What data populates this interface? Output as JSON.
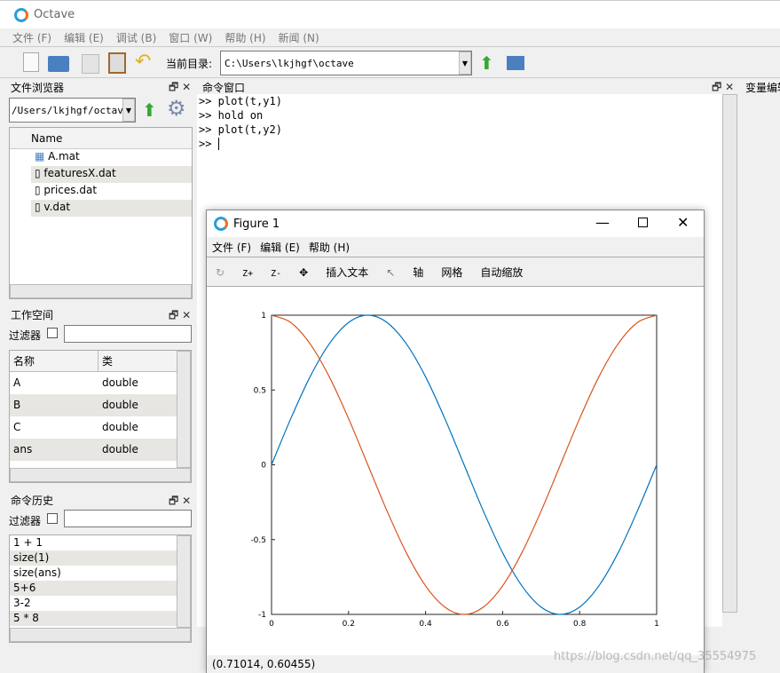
{
  "app": {
    "title": "Octave"
  },
  "menu": [
    "文件 (F)",
    "编辑 (E)",
    "调试 (B)",
    "窗口 (W)",
    "帮助 (H)",
    "新闻 (N)"
  ],
  "toolbar": {
    "cwd_label": "当前目录:",
    "cwd_value": "C:\\Users\\lkjhgf\\octave"
  },
  "file_browser": {
    "title": "文件浏览器",
    "path": "/Users/lkjhgf/octave",
    "column": "Name",
    "files": [
      "A.mat",
      "featuresX.dat",
      "prices.dat",
      "v.dat"
    ]
  },
  "workspace": {
    "title": "工作空间",
    "filter_label": "过滤器",
    "columns": [
      "名称",
      "类"
    ],
    "rows": [
      [
        "A",
        "double"
      ],
      [
        "B",
        "double"
      ],
      [
        "C",
        "double"
      ],
      [
        "ans",
        "double"
      ]
    ]
  },
  "history": {
    "title": "命令历史",
    "filter_label": "过滤器",
    "items": [
      "1 + 1",
      "size(1)",
      "size(ans)",
      "5+6",
      "3-2",
      "5 * 8"
    ]
  },
  "command_window": {
    "title": "命令窗口",
    "lines": [
      ">> plot(t,y1)",
      ">> hold on",
      ">> plot(t,y2)",
      ">> "
    ]
  },
  "variable_editor": {
    "title": "变量编辑器"
  },
  "figure": {
    "title": "Figure 1",
    "menu": [
      "文件 (F)",
      "编辑 (E)",
      "帮助 (H)"
    ],
    "toolbar": [
      "Z+",
      "Z-",
      "插入文本",
      "轴",
      "网格",
      "自动缩放"
    ],
    "status": "(0.71014, 0.60455)"
  },
  "watermark": "https://blog.csdn.net/qq_35554975",
  "chart_data": {
    "type": "line",
    "xlim": [
      0,
      1
    ],
    "ylim": [
      -1,
      1
    ],
    "xticks": [
      "0",
      "0.2",
      "0.4",
      "0.6",
      "0.8",
      "1"
    ],
    "yticks": [
      "1",
      "0.5",
      "0",
      "-0.5",
      "-1"
    ],
    "x": [
      0,
      0.05,
      0.1,
      0.15,
      0.2,
      0.25,
      0.3,
      0.35,
      0.4,
      0.45,
      0.5,
      0.55,
      0.6,
      0.65,
      0.7,
      0.75,
      0.8,
      0.85,
      0.9,
      0.95,
      1
    ],
    "series": [
      {
        "color": "#0072bd",
        "values": [
          0,
          0.309,
          0.588,
          0.809,
          0.951,
          1,
          0.951,
          0.809,
          0.588,
          0.309,
          0,
          -0.309,
          -0.588,
          -0.809,
          -0.951,
          -1,
          -0.951,
          -0.809,
          -0.588,
          -0.309,
          0
        ]
      },
      {
        "color": "#d95319",
        "values": [
          1,
          0.951,
          0.809,
          0.588,
          0.309,
          0,
          -0.309,
          -0.588,
          -0.809,
          -0.951,
          -1,
          -0.951,
          -0.809,
          -0.588,
          -0.309,
          0,
          0.309,
          0.588,
          0.809,
          0.951,
          1
        ]
      }
    ],
    "grid": false
  }
}
